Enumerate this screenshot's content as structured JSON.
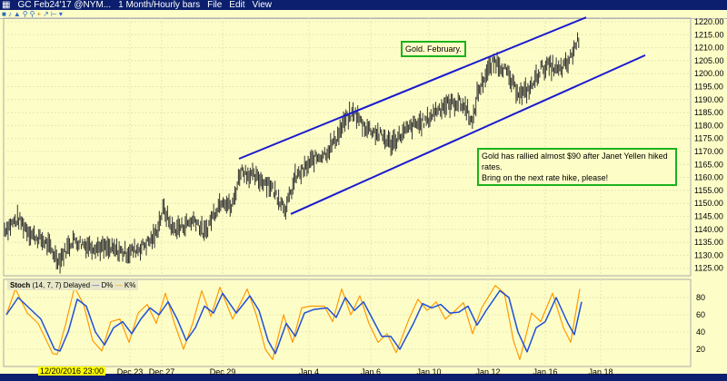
{
  "window": {
    "symbol": "GC Feb24'17 @NYM...",
    "period": "1 Month/Hourly bars",
    "menu": [
      "File",
      "Edit",
      "View"
    ],
    "toolbar_icons": [
      "cursor-icon",
      "bar-icon",
      "line-icon",
      "zoom-in-icon",
      "zoom-out-icon",
      "crosshair-icon",
      "draw-icon"
    ]
  },
  "annotations": {
    "title_note": "Gold. February.",
    "comment": [
      "Gold has rallied almost $90 after Janet Yellen hiked rates.",
      "Bring on the next rate hike, please!"
    ]
  },
  "stoch": {
    "label": "Stoch",
    "params": "(14, 7, 7) Delayed",
    "d_label": "D%",
    "k_label": "K%"
  },
  "cursor_date": "12/20/2016 23:00",
  "colors": {
    "bg": "#fdfdc8",
    "price": "#333333",
    "channel": "#1a1ad0",
    "d": "#1f4fd8",
    "k": "#ff9a00",
    "note_border": "#1bb31b"
  },
  "chart_data": [
    {
      "type": "line",
      "title": "GC Feb24'17 hourly bars",
      "ylim": [
        1120,
        1222
      ],
      "xlim": [
        0,
        760
      ],
      "yticks": [
        1220,
        1215,
        1210,
        1205,
        1200,
        1195,
        1190,
        1185,
        1180,
        1175,
        1170,
        1165,
        1160,
        1155,
        1150,
        1145,
        1140,
        1135,
        1130,
        1125
      ],
      "xticks": [
        {
          "x": 143,
          "label": "Dec 23"
        },
        {
          "x": 178,
          "label": "Dec 27"
        },
        {
          "x": 245,
          "label": "Dec 29"
        },
        {
          "x": 340,
          "label": "Jan 4"
        },
        {
          "x": 408,
          "label": "Jan 6"
        },
        {
          "x": 472,
          "label": "Jan 10"
        },
        {
          "x": 537,
          "label": "Jan 12"
        },
        {
          "x": 600,
          "label": "Jan 16"
        },
        {
          "x": 661,
          "label": "Jan 18"
        }
      ],
      "price": [
        [
          5,
          1140
        ],
        [
          20,
          1144
        ],
        [
          35,
          1138
        ],
        [
          50,
          1135
        ],
        [
          65,
          1128
        ],
        [
          80,
          1136
        ],
        [
          95,
          1134
        ],
        [
          110,
          1133
        ],
        [
          125,
          1132
        ],
        [
          140,
          1131
        ],
        [
          155,
          1133
        ],
        [
          170,
          1137
        ],
        [
          180,
          1148
        ],
        [
          190,
          1140
        ],
        [
          200,
          1141
        ],
        [
          215,
          1144
        ],
        [
          225,
          1138
        ],
        [
          235,
          1146
        ],
        [
          245,
          1152
        ],
        [
          255,
          1148
        ],
        [
          265,
          1163
        ],
        [
          280,
          1160
        ],
        [
          295,
          1158
        ],
        [
          305,
          1153
        ],
        [
          315,
          1148
        ],
        [
          325,
          1160
        ],
        [
          335,
          1163
        ],
        [
          345,
          1167
        ],
        [
          360,
          1170
        ],
        [
          370,
          1175
        ],
        [
          380,
          1182
        ],
        [
          390,
          1185
        ],
        [
          400,
          1180
        ],
        [
          410,
          1178
        ],
        [
          420,
          1176
        ],
        [
          430,
          1173
        ],
        [
          440,
          1176
        ],
        [
          455,
          1180
        ],
        [
          470,
          1182
        ],
        [
          480,
          1186
        ],
        [
          490,
          1188
        ],
        [
          505,
          1189
        ],
        [
          515,
          1186
        ],
        [
          520,
          1180
        ],
        [
          525,
          1192
        ],
        [
          535,
          1200
        ],
        [
          545,
          1205
        ],
        [
          555,
          1202
        ],
        [
          565,
          1195
        ],
        [
          575,
          1192
        ],
        [
          585,
          1195
        ],
        [
          595,
          1202
        ],
        [
          605,
          1203
        ],
        [
          615,
          1201
        ],
        [
          625,
          1204
        ],
        [
          630,
          1208
        ],
        [
          637,
          1214
        ]
      ],
      "channel": [
        [
          [
            263,
            1167.2
          ],
          [
            645,
            1221.7
          ]
        ],
        [
          [
            320,
            1145.9
          ],
          [
            710,
            1207.1
          ]
        ]
      ]
    },
    {
      "type": "line",
      "title": "Stoch",
      "ylim": [
        0,
        100
      ],
      "yticks": [
        80,
        60,
        40,
        20
      ],
      "D": [
        [
          7,
          60
        ],
        [
          20,
          80
        ],
        [
          35,
          65
        ],
        [
          45,
          55
        ],
        [
          60,
          20
        ],
        [
          66,
          18
        ],
        [
          75,
          40
        ],
        [
          85,
          78
        ],
        [
          95,
          70
        ],
        [
          105,
          40
        ],
        [
          115,
          25
        ],
        [
          125,
          45
        ],
        [
          135,
          52
        ],
        [
          145,
          38
        ],
        [
          155,
          55
        ],
        [
          165,
          68
        ],
        [
          175,
          60
        ],
        [
          185,
          75
        ],
        [
          195,
          55
        ],
        [
          205,
          30
        ],
        [
          215,
          45
        ],
        [
          225,
          70
        ],
        [
          235,
          62
        ],
        [
          245,
          85
        ],
        [
          260,
          62
        ],
        [
          275,
          82
        ],
        [
          285,
          65
        ],
        [
          295,
          30
        ],
        [
          303,
          15
        ],
        [
          315,
          50
        ],
        [
          325,
          35
        ],
        [
          335,
          62
        ],
        [
          345,
          66
        ],
        [
          360,
          68
        ],
        [
          370,
          57
        ],
        [
          380,
          80
        ],
        [
          390,
          65
        ],
        [
          400,
          75
        ],
        [
          410,
          55
        ],
        [
          420,
          35
        ],
        [
          430,
          35
        ],
        [
          440,
          20
        ],
        [
          455,
          50
        ],
        [
          465,
          73
        ],
        [
          475,
          68
        ],
        [
          485,
          72
        ],
        [
          495,
          62
        ],
        [
          505,
          63
        ],
        [
          515,
          70
        ],
        [
          525,
          48
        ],
        [
          535,
          65
        ],
        [
          550,
          88
        ],
        [
          560,
          80
        ],
        [
          570,
          40
        ],
        [
          580,
          17
        ],
        [
          590,
          45
        ],
        [
          600,
          52
        ],
        [
          612,
          80
        ],
        [
          625,
          50
        ],
        [
          632,
          37
        ],
        [
          640,
          75
        ]
      ],
      "K": [
        [
          7,
          60
        ],
        [
          17,
          90
        ],
        [
          30,
          62
        ],
        [
          42,
          50
        ],
        [
          58,
          15
        ],
        [
          63,
          14
        ],
        [
          72,
          48
        ],
        [
          82,
          92
        ],
        [
          92,
          72
        ],
        [
          102,
          30
        ],
        [
          112,
          18
        ],
        [
          122,
          52
        ],
        [
          132,
          55
        ],
        [
          142,
          28
        ],
        [
          152,
          62
        ],
        [
          162,
          72
        ],
        [
          172,
          50
        ],
        [
          182,
          85
        ],
        [
          192,
          50
        ],
        [
          202,
          20
        ],
        [
          212,
          50
        ],
        [
          222,
          88
        ],
        [
          232,
          58
        ],
        [
          242,
          92
        ],
        [
          256,
          55
        ],
        [
          272,
          90
        ],
        [
          282,
          60
        ],
        [
          292,
          20
        ],
        [
          300,
          8
        ],
        [
          312,
          60
        ],
        [
          322,
          28
        ],
        [
          332,
          68
        ],
        [
          342,
          70
        ],
        [
          357,
          70
        ],
        [
          366,
          52
        ],
        [
          376,
          90
        ],
        [
          386,
          60
        ],
        [
          396,
          82
        ],
        [
          406,
          50
        ],
        [
          416,
          28
        ],
        [
          426,
          38
        ],
        [
          436,
          16
        ],
        [
          450,
          55
        ],
        [
          460,
          78
        ],
        [
          470,
          65
        ],
        [
          480,
          75
        ],
        [
          490,
          55
        ],
        [
          500,
          64
        ],
        [
          510,
          74
        ],
        [
          520,
          38
        ],
        [
          530,
          68
        ],
        [
          545,
          94
        ],
        [
          555,
          85
        ],
        [
          565,
          30
        ],
        [
          572,
          8
        ],
        [
          585,
          62
        ],
        [
          595,
          52
        ],
        [
          608,
          85
        ],
        [
          620,
          45
        ],
        [
          628,
          28
        ],
        [
          638,
          90
        ]
      ]
    }
  ]
}
